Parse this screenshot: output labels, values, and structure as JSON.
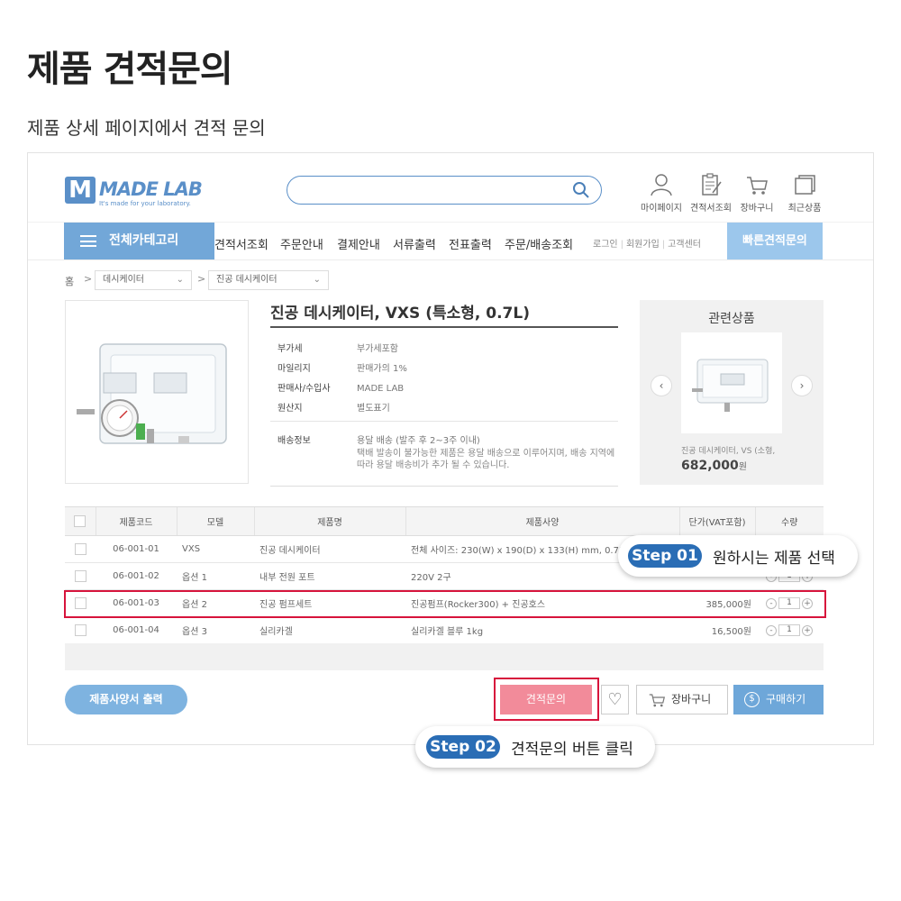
{
  "page": {
    "title": "제품 견적문의",
    "subtitle": "제품 상세 페이지에서 견적 문의"
  },
  "header": {
    "logo_text": "MADE LAB",
    "logo_letter": "M",
    "logo_tagline": "It's made for your laboratory.",
    "search_placeholder": "",
    "utils": [
      {
        "label": "마이페이지",
        "icon": "user-icon"
      },
      {
        "label": "견적서조회",
        "icon": "clipboard-icon"
      },
      {
        "label": "장바구니",
        "icon": "cart-icon"
      },
      {
        "label": "최근상품",
        "icon": "recent-icon"
      }
    ]
  },
  "nav": {
    "category_label": "전체카테고리",
    "items": [
      "견적서조회",
      "주문안내",
      "결제안내",
      "서류출력",
      "전표출력",
      "주문/배송조회"
    ],
    "util_links": [
      "로그인",
      "회원가입",
      "고객센터"
    ],
    "quick_label": "빠른견적문의"
  },
  "breadcrumb": {
    "home": "홈",
    "arrow": ">",
    "level1": "데시케이터",
    "level2": "진공 데시케이터"
  },
  "product": {
    "title": "진공 데시케이터, VXS (특소형, 0.7L)",
    "specs": [
      {
        "label": "부가세",
        "value": "부가세포함"
      },
      {
        "label": "마일리지",
        "value": "판매가의 1%"
      },
      {
        "label": "판매사/수입사",
        "value": "MADE LAB"
      },
      {
        "label": "원산지",
        "value": "별도표기"
      }
    ],
    "shipping_label": "배송정보",
    "shipping_value": "용달 배송 (발주 후 2~3주 이내)",
    "shipping_note": "택배 발송이 불가능한 제품은 용달 배송으로 이루어지며, 배송 지역에 따라 용달 배송비가 추가 될 수 있습니다."
  },
  "related": {
    "title": "관련상품",
    "name": "진공 데시케이터, VS (소형,",
    "price": "682,000",
    "price_unit": "원",
    "prev": "‹",
    "next": "›"
  },
  "table": {
    "headers": [
      "",
      "제품코드",
      "모델",
      "제품명",
      "제품사양",
      "단가(VAT포함)",
      "수량"
    ],
    "rows": [
      {
        "code": "06-001-01",
        "model": "VXS",
        "name": "진공 데시케이터",
        "spec": "전체 사이즈: 230(W) x 190(D) x 133(H) mm, 0.7L",
        "price": "",
        "qty": "1"
      },
      {
        "code": "06-001-02",
        "model": "옵션 1",
        "name": "내부 전원 포트",
        "spec": "220V 2구",
        "price": "",
        "qty": "1"
      },
      {
        "code": "06-001-03",
        "model": "옵션 2",
        "name": "진공 펌프세트",
        "spec": "진공펌프(Rocker300) + 진공호스",
        "price": "385,000원",
        "qty": "1"
      },
      {
        "code": "06-001-04",
        "model": "옵션 3",
        "name": "실리카겔",
        "spec": "실리카겔 블루 1kg",
        "price": "16,500원",
        "qty": "1"
      }
    ],
    "qty_minus": "-",
    "qty_plus": "+"
  },
  "buttons": {
    "spec_print": "제품사양서 출력",
    "quote": "견적문의",
    "wishlist_icon": "♡",
    "cart": "장바구니",
    "buy": "구매하기",
    "buy_icon_glyph": "$"
  },
  "callouts": [
    {
      "badge": "Step 01",
      "text": "원하시는 제품 선택"
    },
    {
      "badge": "Step 02",
      "text": "견적문의 버튼 클릭"
    }
  ],
  "colors": {
    "brand": "#5a8fc8",
    "highlight": "#d7143c",
    "quote_button": "#f28b9a",
    "step_badge": "#2a6db5"
  }
}
